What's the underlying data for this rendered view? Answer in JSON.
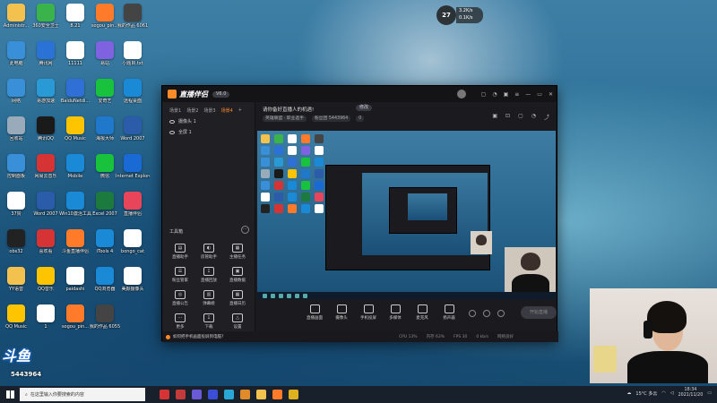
{
  "desktop": {
    "icons": [
      {
        "label": "Administr...",
        "color": "#f2c14e"
      },
      {
        "label": "360安全卫士",
        "color": "#3ab34a"
      },
      {
        "label": "8.21",
        "color": "#ffffff"
      },
      {
        "label": "sogou_pin...",
        "color": "#ff7b2a"
      },
      {
        "label": "我的作品 6061",
        "color": "#444"
      },
      {
        "label": "此电脑",
        "color": "#3a8fd9"
      },
      {
        "label": "腾讯网",
        "color": "#2a72d6"
      },
      {
        "label": "11111",
        "color": "#ffffff"
      },
      {
        "label": "易站",
        "color": "#7f62e0"
      },
      {
        "label": "小题目.txt",
        "color": "#ffffff"
      },
      {
        "label": "网络",
        "color": "#3a8fd9"
      },
      {
        "label": "易游加速",
        "color": "#2a9ad6"
      },
      {
        "label": "BaiduNetdi...",
        "color": "#2f6fd6"
      },
      {
        "label": "爱奇艺",
        "color": "#19c23d"
      },
      {
        "label": "远程桌面",
        "color": "#1a8ad6"
      },
      {
        "label": "回收站",
        "color": "#9ab"
      },
      {
        "label": "腾讯QQ",
        "color": "#1a1a1a"
      },
      {
        "label": "QQ Music",
        "color": "#ffc400"
      },
      {
        "label": "海报大师",
        "color": "#1f78c9"
      },
      {
        "label": "Word 2007",
        "color": "#2a5caa"
      },
      {
        "label": "控制面板",
        "color": "#3a8fd9"
      },
      {
        "label": "网易云音乐",
        "color": "#d63434"
      },
      {
        "label": "Mobile",
        "color": "#1a8ad6"
      },
      {
        "label": "微信",
        "color": "#19c23d"
      },
      {
        "label": "Internet Explorer",
        "color": "#1a6ad6"
      },
      {
        "label": "37赞",
        "color": "#fff"
      },
      {
        "label": "Word 2007",
        "color": "#2a5caa"
      },
      {
        "label": "Win10激活工具",
        "color": "#1a8ad6"
      },
      {
        "label": "Excel 2007",
        "color": "#1d7a3e"
      },
      {
        "label": "直播伴侣",
        "color": "#e8455a"
      },
      {
        "label": "obs32",
        "color": "#222"
      },
      {
        "label": "喜欢看",
        "color": "#d63434"
      },
      {
        "label": "斗鱼直播伴侣",
        "color": "#ff7b2a"
      },
      {
        "label": "iTools 4",
        "color": "#1a8ad6"
      },
      {
        "label": "bongo_cat",
        "color": "#fff"
      },
      {
        "label": "YY语音",
        "color": "#f2c14e"
      },
      {
        "label": "QQ音乐",
        "color": "#ffc400"
      },
      {
        "label": "paidashi",
        "color": "#fff"
      },
      {
        "label": "QQ浏览器",
        "color": "#1a8ad6"
      },
      {
        "label": "美颜摄像头",
        "color": "#fff"
      },
      {
        "label": "QQ Music",
        "color": "#ffc400"
      },
      {
        "label": "1",
        "color": "#fff"
      },
      {
        "label": "sogou_pin...",
        "color": "#ff7b2a"
      },
      {
        "label": "我的作品 6055",
        "color": "#444"
      }
    ]
  },
  "net_widget": {
    "cpu": "27",
    "up": "3.2K/s",
    "down": "0.1K/s"
  },
  "app": {
    "name": "直播伴侣",
    "version": "V6.0",
    "scene_tabs": [
      "场景1",
      "场景2",
      "场景3",
      "场景4"
    ],
    "sources": [
      "摄像头 1",
      "全屏 1"
    ],
    "tools_title": "工具箱",
    "tools": [
      {
        "label": "直播助手",
        "glyph": "▤"
      },
      {
        "label": "房管助手",
        "glyph": "◐"
      },
      {
        "label": "主播任务",
        "glyph": "▦"
      },
      {
        "label": "粉丝管家",
        "glyph": "☰"
      },
      {
        "label": "直播回放",
        "glyph": "↧"
      },
      {
        "label": "直播数据",
        "glyph": "▣"
      },
      {
        "label": "直播公告",
        "glyph": "◎"
      },
      {
        "label": "弹幕姬",
        "glyph": "▥"
      },
      {
        "label": "直播日历",
        "glyph": "▦"
      },
      {
        "label": "更多",
        "glyph": "⋯"
      },
      {
        "label": "下载",
        "glyph": "↧"
      },
      {
        "label": "设置",
        "glyph": "△"
      }
    ],
    "notice": "如何把手机画面投屏到电脑?",
    "room_title": "请你备好直播人的机遇!",
    "edit_label": "修改",
    "room_meta": [
      "英雄联盟 · 职业选手",
      "粉丝团 5443964",
      "0"
    ],
    "bottom_buttons": [
      "直播画面",
      "摄像头",
      "手机投屏",
      "多媒体",
      "麦克风",
      "扬声器"
    ],
    "start_live": "开始直播",
    "status": [
      "CPU 13%",
      "内存 63%",
      "FPS 30",
      "0 kb/s",
      "网络良好"
    ]
  },
  "stream_overlay": {
    "brand": "斗鱼",
    "room_id": "5443964"
  },
  "taskbar": {
    "search_placeholder": "在这里输入你要搜索的内容",
    "weather": "15°C 多云",
    "time": "18:34",
    "date": "2021/11/20"
  }
}
